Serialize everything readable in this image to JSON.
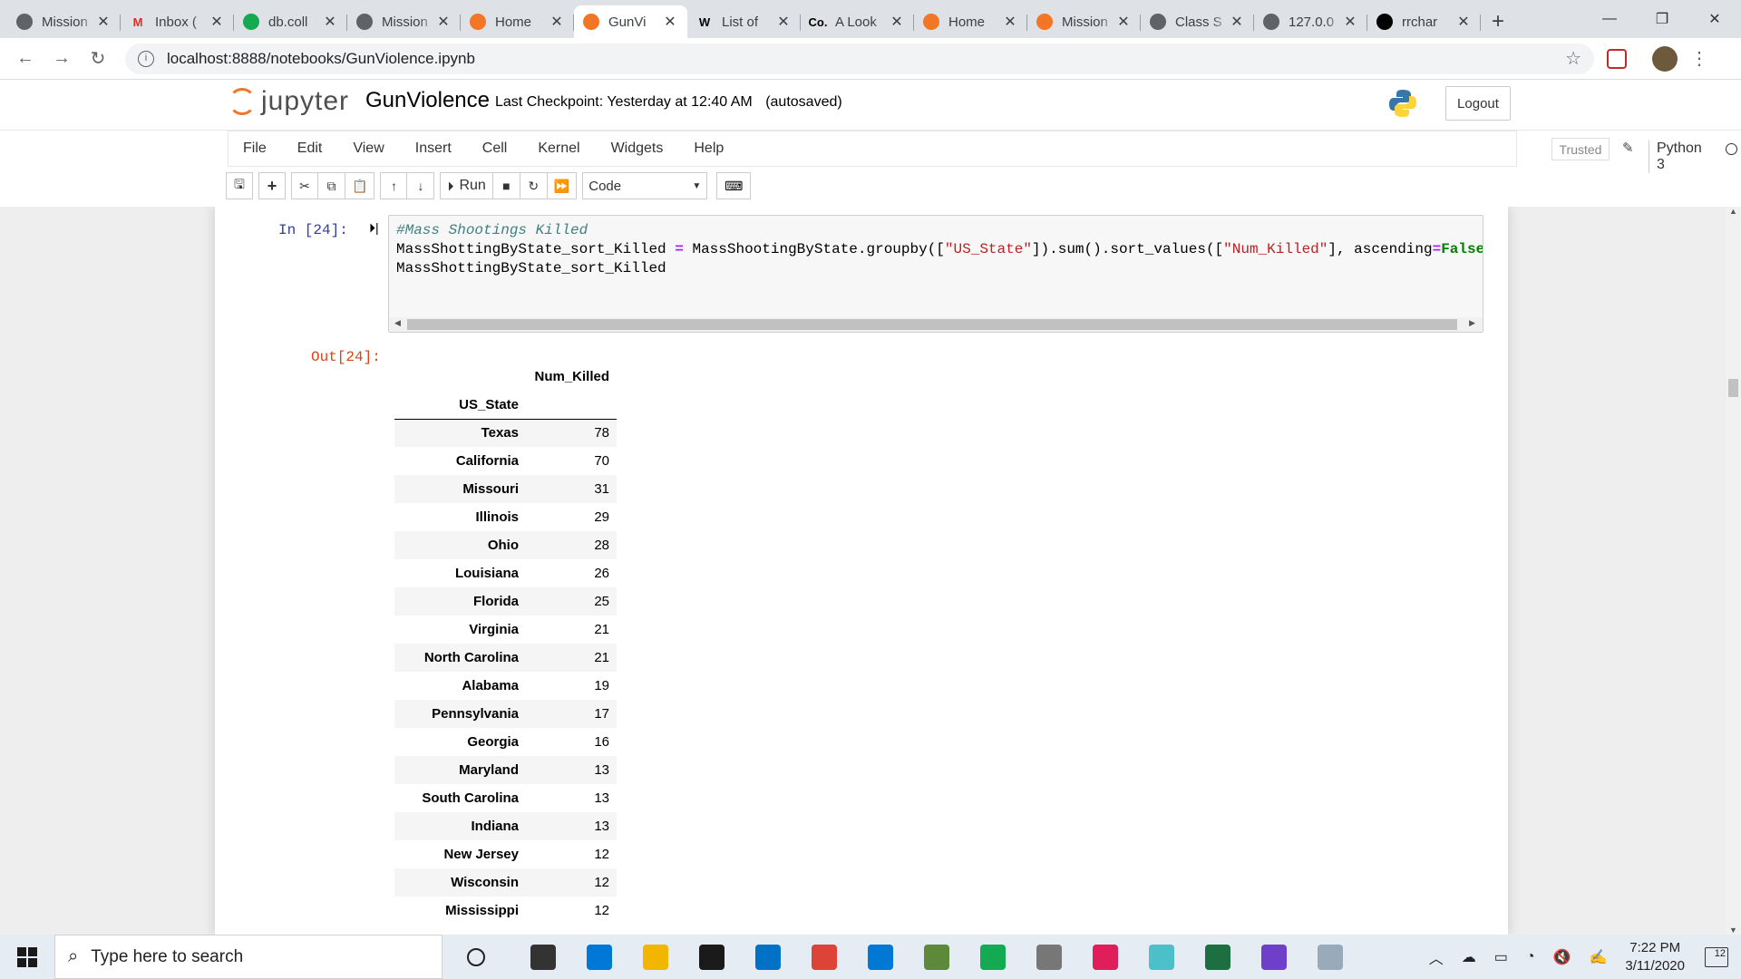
{
  "browser": {
    "tabs": [
      {
        "title": "Mission",
        "fav": "#5f6368",
        "icon": "globe-icon"
      },
      {
        "title": "Inbox (",
        "fav": "#d93025",
        "icon": "gmail-icon"
      },
      {
        "title": "db.coll",
        "fav": "#13aa52",
        "icon": "mongodb-icon"
      },
      {
        "title": "Mission",
        "fav": "#5f6368",
        "icon": "globe-icon"
      },
      {
        "title": "Home",
        "fav": "#f37626",
        "icon": "jupyter-icon"
      },
      {
        "title": "GunVi",
        "fav": "#f37626",
        "icon": "notebook-icon",
        "active": true
      },
      {
        "title": "List of",
        "fav": "#000000",
        "icon": "wikipedia-icon"
      },
      {
        "title": "A Look",
        "fav": "#000000",
        "icon": "co-icon"
      },
      {
        "title": "Home",
        "fav": "#f37626",
        "icon": "jupyter-icon"
      },
      {
        "title": "Mission",
        "fav": "#f37626",
        "icon": "notebook-icon"
      },
      {
        "title": "Class S",
        "fav": "#5f6368",
        "icon": "globe-icon"
      },
      {
        "title": "127.0.0",
        "fav": "#5f6368",
        "icon": "globe-icon"
      },
      {
        "title": "rrchar",
        "fav": "#000000",
        "icon": "github-icon"
      }
    ],
    "tab_glyphs": {
      "gmail-icon": "M",
      "wikipedia-icon": "W",
      "co-icon": "Co."
    },
    "url": "localhost:8888/notebooks/GunViolence.ipynb"
  },
  "jupyter": {
    "logo_text": "jupyter",
    "notebook_name": "GunViolence",
    "checkpoint": "Last Checkpoint: Yesterday at 12:40 AM",
    "autosaved": "(autosaved)",
    "logout": "Logout",
    "menu": [
      "File",
      "Edit",
      "View",
      "Insert",
      "Cell",
      "Kernel",
      "Widgets",
      "Help"
    ],
    "trusted": "Trusted",
    "kernel": "Python 3",
    "run_label": "Run",
    "cell_type": "Code"
  },
  "cell": {
    "in_prompt": "In [24]:",
    "out_prompt": "Out[24]:",
    "code_comment": "#Mass Shootings Killed",
    "code_line2_a": "MassShottingByState_sort_Killed ",
    "code_eq": "=",
    "code_line2_b": " MassShootingByState.groupby([",
    "code_str1": "\"US_State\"",
    "code_line2_c": "]).sum().sort_values([",
    "code_str2": "\"Num_Killed\"",
    "code_line2_d": "], ascending",
    "code_eq2": "=",
    "code_kw": "False",
    "code_line3": "MassShottingByState_sort_Killed"
  },
  "table": {
    "col_header": "Num_Killed",
    "index_header": "US_State",
    "rows": [
      [
        "Texas",
        "78"
      ],
      [
        "California",
        "70"
      ],
      [
        "Missouri",
        "31"
      ],
      [
        "Illinois",
        "29"
      ],
      [
        "Ohio",
        "28"
      ],
      [
        "Louisiana",
        "26"
      ],
      [
        "Florida",
        "25"
      ],
      [
        "Virginia",
        "21"
      ],
      [
        "North Carolina",
        "21"
      ],
      [
        "Alabama",
        "19"
      ],
      [
        "Pennsylvania",
        "17"
      ],
      [
        "Georgia",
        "16"
      ],
      [
        "Maryland",
        "13"
      ],
      [
        "South Carolina",
        "13"
      ],
      [
        "Indiana",
        "13"
      ],
      [
        "New Jersey",
        "12"
      ],
      [
        "Wisconsin",
        "12"
      ],
      [
        "Mississippi",
        "12"
      ]
    ]
  },
  "taskbar": {
    "search_placeholder": "Type here to search",
    "time": "7:22 PM",
    "date": "3/11/2020",
    "notifications": "12",
    "apps": [
      {
        "name": "task-view-icon",
        "color": "#333333"
      },
      {
        "name": "edge-icon",
        "color": "#0078d7"
      },
      {
        "name": "file-explorer-icon",
        "color": "#f2b600"
      },
      {
        "name": "store-icon",
        "color": "#1a1a1a"
      },
      {
        "name": "mail-icon",
        "color": "#0072c6"
      },
      {
        "name": "chrome-icon",
        "color": "#db4437"
      },
      {
        "name": "vscode-icon",
        "color": "#0078d4"
      },
      {
        "name": "app-icon",
        "color": "#5c8a3a"
      },
      {
        "name": "mongodb-compass-icon",
        "color": "#13aa52"
      },
      {
        "name": "pen-icon",
        "color": "#777777"
      },
      {
        "name": "slack-icon",
        "color": "#e01e5a"
      },
      {
        "name": "gitkraken-icon",
        "color": "#4bc0c8"
      },
      {
        "name": "excel-icon",
        "color": "#1d6f42"
      },
      {
        "name": "github-desktop-icon",
        "color": "#6e40c9"
      },
      {
        "name": "paint-icon",
        "color": "#9ab"
      }
    ]
  }
}
